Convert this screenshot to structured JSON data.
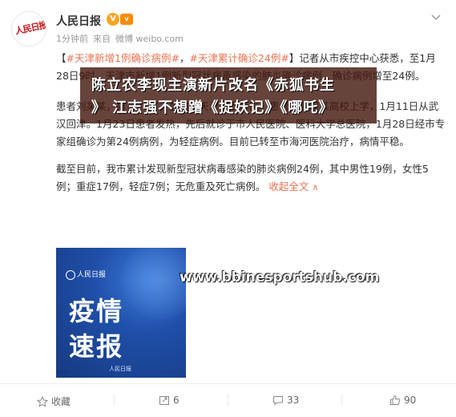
{
  "post": {
    "avatar_text": "人民日报",
    "username": "人民日报",
    "verified_badge": "V",
    "vip_badge": "v",
    "meta": {
      "time": "1分钟前",
      "source_prefix": "来自",
      "source": "微博 weibo.com"
    },
    "paragraph1": {
      "tag1": "#天津新增1例确诊病例#",
      "tag_sep": "，",
      "tag2": "#天津累计确诊24例#",
      "text_a": "】记者从市疾控中心获悉，至1月28日9时，天津市新增1例新型冠状病毒感染的肺炎确诊病例，确诊病例增至24例。",
      "bracket_open": "【"
    },
    "paragraph2": "患者刘某某，男，21岁，居住于天津市西青区，患者在武汉某高校上学，1月11日从武汉回津。1月23日患者发热，先后就诊于市人民医院、医科大学总医院，1月28日经市专家组确诊为第24例病例，为轻症病例。目前已转至市海河医院治疗，病情平稳。",
    "paragraph3": "截至目前，我市累计发现新型冠状病毒感染的肺炎病例24例，其中男性19例，女性5例；重症17例，轻症7例；无危重及死亡病例。",
    "more_link": "收起全文",
    "more_arrow": "∧"
  },
  "overlay": {
    "line1": "陈立农李现主演新片改名《赤狐书生",
    "line2": "》  江志强不想蹭《捉妖记》《哪吒》"
  },
  "poster": {
    "logo": "人民日报",
    "title_line1": "疫情",
    "title_line2": "速报",
    "footer": "人民日报"
  },
  "watermark": "www.bbinesportshub.com",
  "actions": {
    "favorite_label": "收藏",
    "repost_count": "6",
    "comment_count": "33",
    "like_count": "90"
  }
}
